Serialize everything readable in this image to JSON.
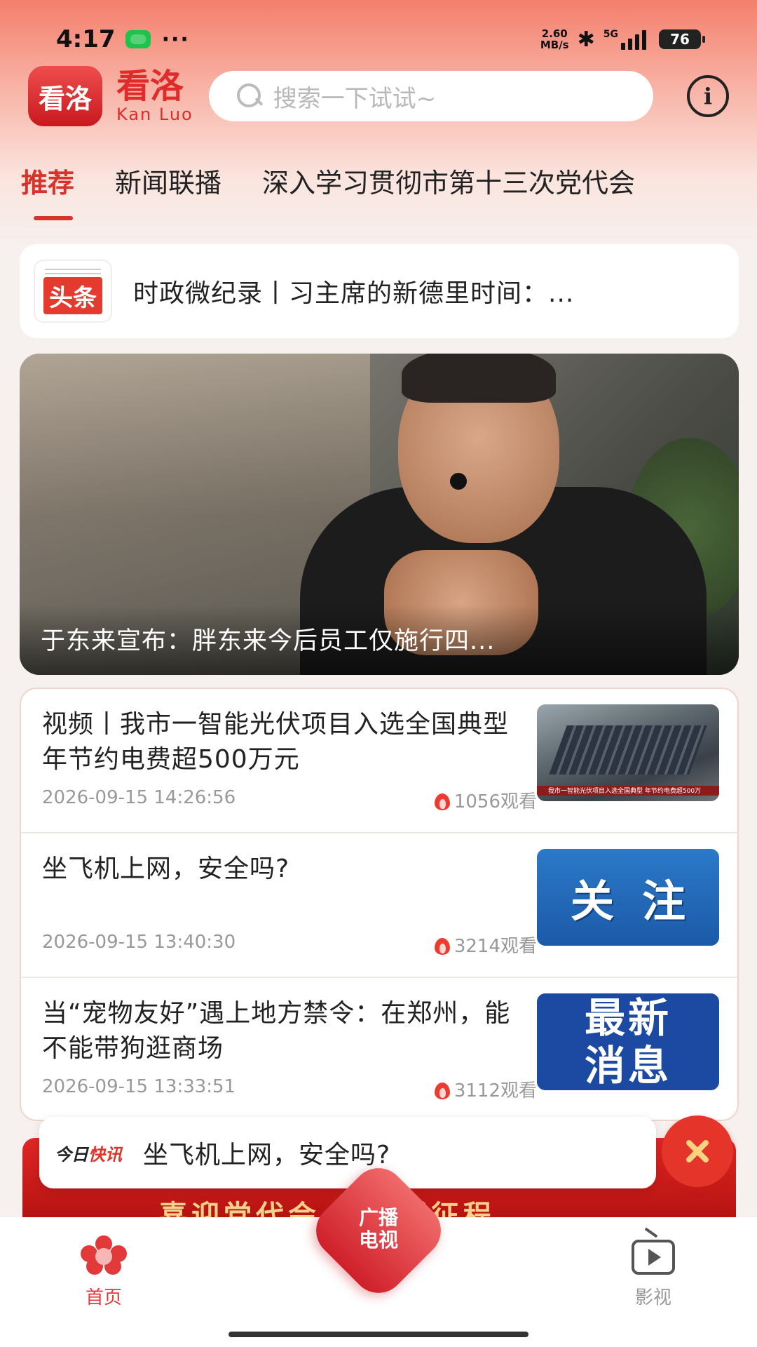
{
  "status_bar": {
    "time": "4:17",
    "more_dots": "···",
    "net_speed_value": "2.60",
    "net_speed_unit": "MB/s",
    "signal_label": "5G",
    "battery": "76"
  },
  "header": {
    "logo_text": "看洛",
    "brand_cn": "看洛",
    "brand_en": "Kan Luo",
    "search_placeholder": "搜索一下试试~",
    "info_icon": "i"
  },
  "tabs": [
    {
      "label": "推荐",
      "active": true
    },
    {
      "label": "新闻联播",
      "active": false
    },
    {
      "label": "深入学习贯彻市第十三次党代会",
      "active": false
    }
  ],
  "headline": {
    "badge": "头条",
    "text": "时政微纪录丨习主席的新德里时间：..."
  },
  "hero": {
    "caption": "于东来宣布：胖东来今后员工仅施行四..."
  },
  "news": [
    {
      "title": "视频丨我市一智能光伏项目入选全国典型年节约电费超500万元",
      "date": "2026-09-15 14:26:56",
      "views": "1056观看",
      "thumb_type": "solar",
      "thumb_caption": "我市一智能光伏项目入选全国典型 年节约电费超500万"
    },
    {
      "title": "坐飞机上网，安全吗?",
      "date": "2026-09-15 13:40:30",
      "views": "3214观看",
      "thumb_type": "blue",
      "thumb_text": "关注"
    },
    {
      "title": "当“宠物友好”遇上地方禁令：在郑州，能不能带狗逛商场",
      "date": "2026-09-15 13:33:51",
      "views": "3112观看",
      "thumb_type": "news",
      "thumb_line1": "最新",
      "thumb_line2": "消息"
    }
  ],
  "banner": {
    "text": "喜迎党代会 奋进新征程"
  },
  "quick_news": {
    "label_a": "今日",
    "label_b": "快讯",
    "text": "坐飞机上网，安全吗?"
  },
  "bottom_nav": {
    "home": "首页",
    "center": "广播\n电视",
    "video": "影视"
  },
  "colors": {
    "accent": "#d8322b",
    "header_gradient_top": "#f47f6c"
  }
}
